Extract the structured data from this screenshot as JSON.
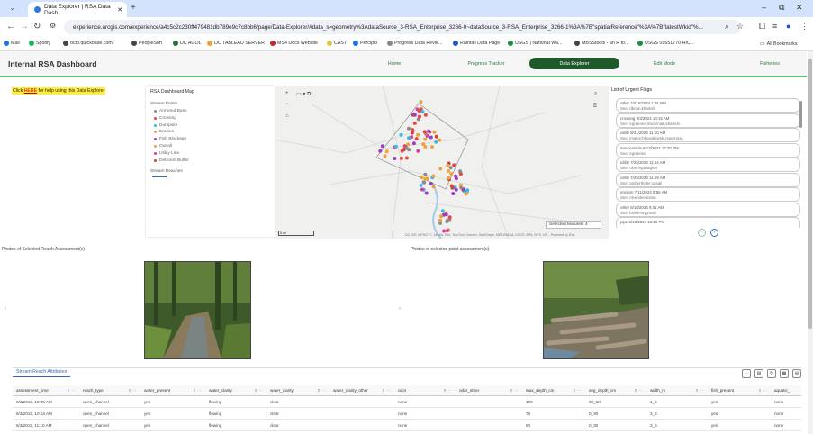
{
  "browser": {
    "tab_title": "Data Explorer | RSA Data Dash",
    "url": "experience.arcgis.com/experience/a4c5c2c230ff479481db789e9c7c8bb6/page/Data-Explorer/#data_s=geometry%3AdataSource_3-RSA_Enterprise_3266-0~dataSource_3-RSA_Enterprise_3266-1%3A%7B\"spatialReference\"%3A%7B\"latestWkid\"%..."
  },
  "bookmarks": [
    "Mail",
    "Spotify",
    "octo.quickbase.com",
    "PeopleSoft",
    "DC AGOL",
    "DC TABLEAU SERVER",
    "MS4 Docs Website",
    "CAST",
    "Percipio",
    "Progress Data Revie...",
    "Rainfall Data Page",
    "USGS | National Wa...",
    "MBSStools - an R to...",
    "USGS 01651770 HIC...",
    "All Bookmarks"
  ],
  "app": {
    "title": "Internal RSA Dashboard",
    "nav": [
      "Home",
      "Progress Tracker",
      "Data Explorer",
      "Edit Mode",
      "Fisheries"
    ],
    "active_nav": "Data Explorer",
    "accent": "#5fb978",
    "help": {
      "pre": "Click ",
      "link": "HERE",
      "post": " for help using this Data Explorer"
    }
  },
  "legend": {
    "title": "RSA Dashboard Map",
    "group1": "Stream Points",
    "items": [
      {
        "label": "Armored Bank",
        "color": "#8c8c8c"
      },
      {
        "label": "Crossing",
        "color": "#e8483f"
      },
      {
        "label": "Dumpsite",
        "color": "#3fb6e8"
      },
      {
        "label": "Erosion",
        "color": "#e8a33f"
      },
      {
        "label": "Fish Blockage",
        "color": "#9b3fc2"
      },
      {
        "label": "Outfall",
        "color": "#f2a23a"
      },
      {
        "label": "Utility Line",
        "color": "#d63f9e"
      },
      {
        "label": "Deficient Buffer",
        "color": "#c9463f"
      }
    ],
    "group2": "Stream Reaches"
  },
  "map": {
    "selected_features": "Selected features: 4",
    "attribution": "DC GIS, MPHOTC, NOAA, Esri, TomTom, Garmin, SafeGraph, METI/NASA, USGS, EPA, NPS, US...    Powered by Esri",
    "scale": "5 mi"
  },
  "flags": {
    "title": "List of Urgent Flags",
    "items": [
      {
        "line1": "other 10/16/2024 1:31 PM",
        "line2": "See: dbrian,kbartels"
      },
      {
        "line1": "crossing 9/3/2024 10:15 AM",
        "line2": "See: egreenes,mwozniak,kbartels"
      },
      {
        "line1": "utility 8/21/2024 11:10 AM",
        "line2": "See: jmalerchkowalewski,mwozniak"
      },
      {
        "line1": "inaccessible 8/13/2024 12:20 PM",
        "line2": "See: egreenes"
      },
      {
        "line1": "utility 7/25/2024 11:54 AM",
        "line2": "See: clee,mgallagher"
      },
      {
        "line1": "utility 7/25/2024 11:59 AM",
        "line2": "See: amberthaler,sdagli"
      },
      {
        "line1": "erosion 7/11/2024 9:56 AM",
        "line2": "See: clee,ldenniston"
      },
      {
        "line1": "other 6/18/2024 9:31 AM",
        "line2": "See: bsilversty,jmasi"
      },
      {
        "line1": "pipe 6/13/2024 12:16 PM",
        "line2": ""
      }
    ]
  },
  "photos": {
    "reach_title": "Photos of Selected Reach Assessment(s)",
    "point_title": "Photos of selected point assessment(s)"
  },
  "table": {
    "tab": "Stream Reach Attributes",
    "columns": [
      "assessment_time",
      "reach_type",
      "water_present",
      "water_clarity",
      "water_clarity",
      "water_clarity_other",
      "odor",
      "odor_other",
      "max_depth_cm",
      "avg_depth_cm",
      "width_m",
      "fish_present",
      "aquatic_"
    ],
    "rows": [
      [
        "6/3/2019, 10:35 AM",
        "open_channel",
        "yes",
        "flowing",
        "clear",
        "",
        "none",
        "",
        "100",
        "30_60",
        "1_3",
        "yes",
        "none"
      ],
      [
        "6/3/2019, 10:53 AM",
        "open_channel",
        "yes",
        "flowing",
        "clear",
        "",
        "none",
        "",
        "75",
        "0_30",
        "3_6",
        "yes",
        "none"
      ],
      [
        "6/3/2019, 11:10 AM",
        "open_channel",
        "yes",
        "flowing",
        "clear",
        "",
        "none",
        "",
        "50",
        "0_30",
        "3_6",
        "yes",
        "none"
      ]
    ]
  }
}
